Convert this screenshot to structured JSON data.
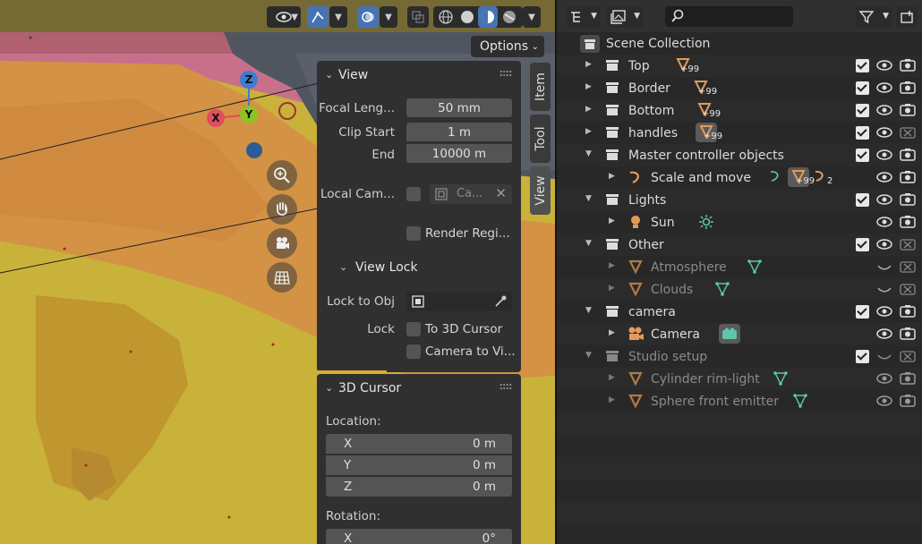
{
  "viewport": {
    "options_label": "Options",
    "gizmo": {
      "z": "Z",
      "y": "Y",
      "x": "X"
    },
    "nav_icons": [
      "zoom-icon",
      "hand-icon",
      "camera-view-icon",
      "grid-icon"
    ]
  },
  "view_panel": {
    "title": "View",
    "focal_length_label": "Focal Leng...",
    "focal_length_value": "50 mm",
    "clip_start_label": "Clip Start",
    "clip_start_value": "1 m",
    "clip_end_label": "End",
    "clip_end_value": "10000 m",
    "local_camera_label": "Local Cam...",
    "local_camera_value": "Ca...",
    "render_region_label": "Render Regi...",
    "view_lock_title": "View Lock",
    "lock_to_obj_label": "Lock to Obj",
    "lock_label": "Lock",
    "to_3d_cursor_label": "To 3D Cursor",
    "camera_to_view_label": "Camera to Vi..."
  },
  "cursor_panel": {
    "title": "3D Cursor",
    "location_label": "Location:",
    "x_label": "X",
    "x_value": "0 m",
    "y_label": "Y",
    "y_value": "0 m",
    "z_label": "Z",
    "z_value": "0 m",
    "rotation_label": "Rotation:",
    "rx_label": "X",
    "rx_value": "0°"
  },
  "tabs": {
    "item": "Item",
    "tool": "Tool",
    "view": "View"
  },
  "outliner": {
    "scene_collection": "Scene Collection",
    "badge_99": "+99",
    "badge_2": "2",
    "rows": {
      "top": "Top",
      "border": "Border",
      "bottom": "Bottom",
      "handles": "handles",
      "master": "Master controller objects",
      "scale_move": "Scale and move",
      "lights": "Lights",
      "sun": "Sun",
      "other": "Other",
      "atmosphere": "Atmosphere",
      "clouds": "Clouds",
      "camera_coll": "camera",
      "camera_obj": "Camera",
      "studio": "Studio setup",
      "cylinder": "Cylinder rim-light",
      "sphere": "Sphere front emitter"
    }
  },
  "colors": {
    "accent_blue": "#4772b3",
    "object_orange": "#e29a5a",
    "mesh_green": "#5fc6a9",
    "gizmo_x": "#e04e5d",
    "gizmo_y": "#8bc424",
    "gizmo_z": "#3f7cd0"
  }
}
